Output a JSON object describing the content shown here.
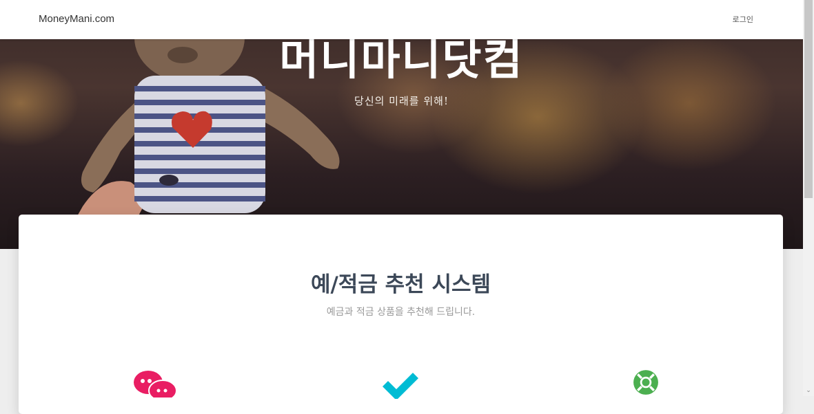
{
  "navbar": {
    "brand": "MoneyMani.com",
    "login_label": "로그인"
  },
  "hero": {
    "title": "머니마니닷컴",
    "subtitle": "당신의 미래를 위해!"
  },
  "section": {
    "title": "예/적금 추천 시스템",
    "description": "예금과 적금 상품을 추천해 드립니다."
  },
  "features": [
    {
      "icon": "chat-bubbles-icon",
      "color": "#e91e63"
    },
    {
      "icon": "check-icon",
      "color": "#00bcd4"
    },
    {
      "icon": "lifebuoy-icon",
      "color": "#4caf50"
    }
  ],
  "colors": {
    "navbar_bg": "#ffffff",
    "title_color": "#3c4858",
    "muted_text": "#999999"
  }
}
